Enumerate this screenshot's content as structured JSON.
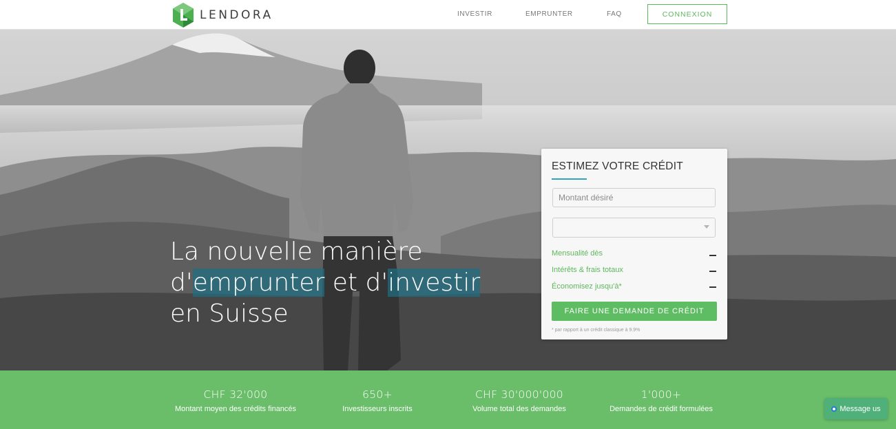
{
  "header": {
    "brand": "LENDORA",
    "nav": {
      "investir": "INVESTIR",
      "emprunter": "EMPRUNTER",
      "faq": "FAQ"
    },
    "login_label": "CONNEXION"
  },
  "hero": {
    "headline": {
      "line1": "La nouvelle manière",
      "line2_prefix": "d'",
      "line2_highlight1": "emprunter",
      "line2_middle": " et d'",
      "line2_highlight2": "investir",
      "line3": "en Suisse"
    }
  },
  "estimator": {
    "title": "ESTIMEZ VOTRE CRÉDIT",
    "amount_placeholder": "Montant désiré",
    "duration_value": "",
    "rows": [
      {
        "label": "Mensualité dès",
        "value": "–"
      },
      {
        "label": "Intérêts & frais totaux",
        "value": "–"
      },
      {
        "label": "Économisez jusqu'à*",
        "value": "–"
      }
    ],
    "submit_label": "FAIRE UNE DEMANDE DE CRÉDIT",
    "footnote": "* par rapport à un crédit classique à 9.9%"
  },
  "stats": [
    {
      "value": "CHF 32'000",
      "label": "Montant moyen des crédits financés"
    },
    {
      "value": "650+",
      "label": "Investisseurs inscrits"
    },
    {
      "value": "CHF 30'000'000",
      "label": "Volume total des demandes"
    },
    {
      "value": "1'000+",
      "label": "Demandes de crédit formulées"
    }
  ],
  "chat": {
    "label": "Message us"
  },
  "colors": {
    "brand_green": "#5cb85c",
    "stats_bar": "#6abe6a",
    "highlight_teal": "#1e6e82",
    "title_underline": "#35a2bd"
  }
}
